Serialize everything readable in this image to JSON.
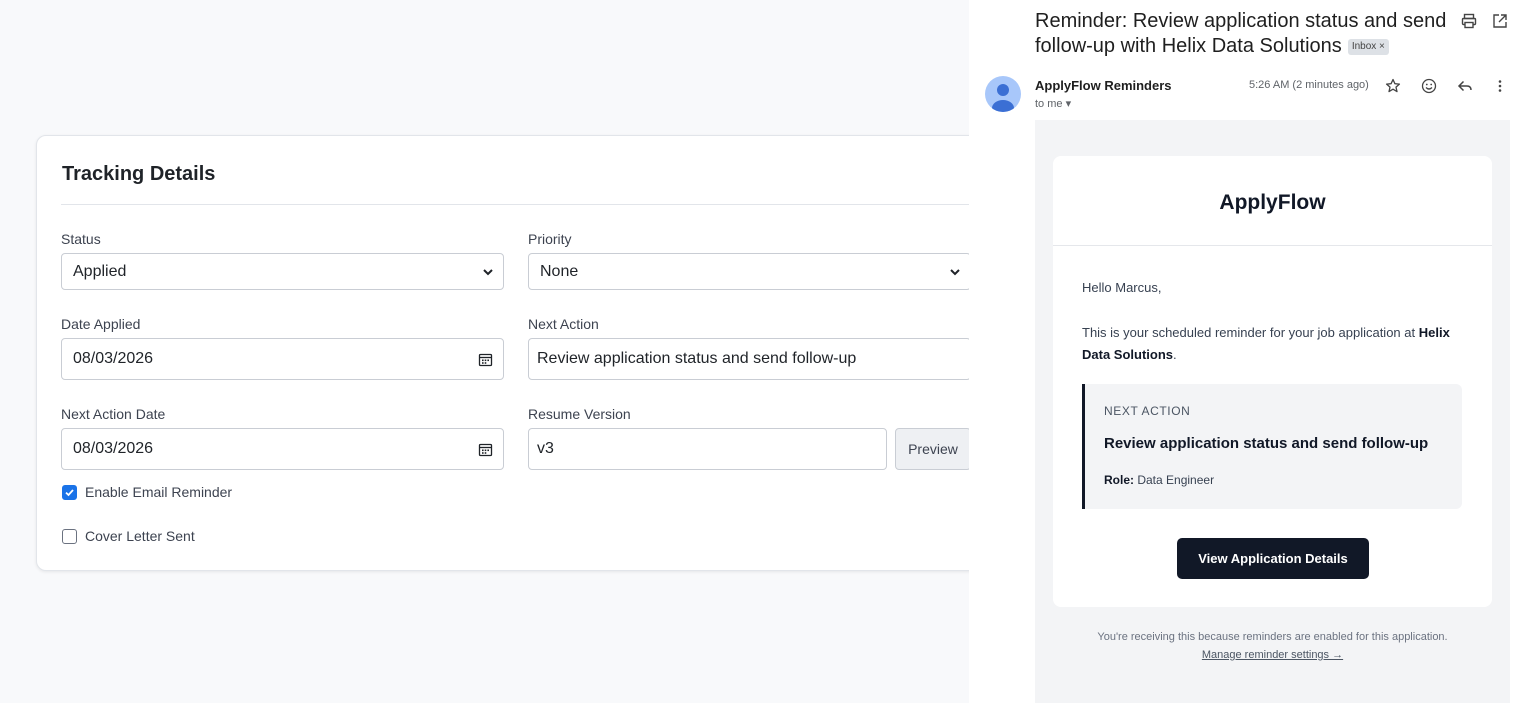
{
  "tracking": {
    "title": "Tracking Details",
    "status_label": "Status",
    "status_value": "Applied",
    "priority_label": "Priority",
    "priority_value": "None",
    "date_applied_label": "Date Applied",
    "date_applied_value": "08/03/2026",
    "next_action_label": "Next Action",
    "next_action_value": "Review application status and send follow-up",
    "next_action_date_label": "Next Action Date",
    "next_action_date_value": "08/03/2026",
    "resume_version_label": "Resume Version",
    "resume_version_value": "v3",
    "preview_label": "Preview",
    "email_reminder_label": "Enable Email Reminder",
    "email_reminder_checked": true,
    "cover_letter_label": "Cover Letter Sent",
    "cover_letter_checked": false
  },
  "email": {
    "subject": "Reminder: Review application status and send follow-up with Helix Data Solutions",
    "inbox_chip": "Inbox ×",
    "sender": "ApplyFlow Reminders",
    "to": "to me ▾",
    "timestamp": "5:26 AM (2 minutes ago)",
    "brand": "ApplyFlow",
    "greeting": "Hello Marcus,",
    "intro_text": "This is your scheduled reminder for your job application at",
    "company": "Helix Data Solutions",
    "intro_end": ".",
    "next_action_label": "NEXT ACTION",
    "next_action_title": "Review application status and send follow-up",
    "role_label": "Role:",
    "role_value": "Data Engineer",
    "cta_label": "View Application Details",
    "footer_note": "You're receiving this because reminders are enabled for this application.",
    "footer_link": "Manage reminder settings →"
  },
  "icons": {
    "print": "print-icon",
    "open_new": "open-in-new-icon",
    "star": "star-icon",
    "emoji": "emoji-icon",
    "reply": "reply-icon",
    "more": "more-vert-icon",
    "calendar": "calendar-icon",
    "chevron": "chevron-down-icon",
    "check": "check-icon"
  },
  "colors": {
    "accent": "#1a73e8",
    "dark": "#111827"
  }
}
